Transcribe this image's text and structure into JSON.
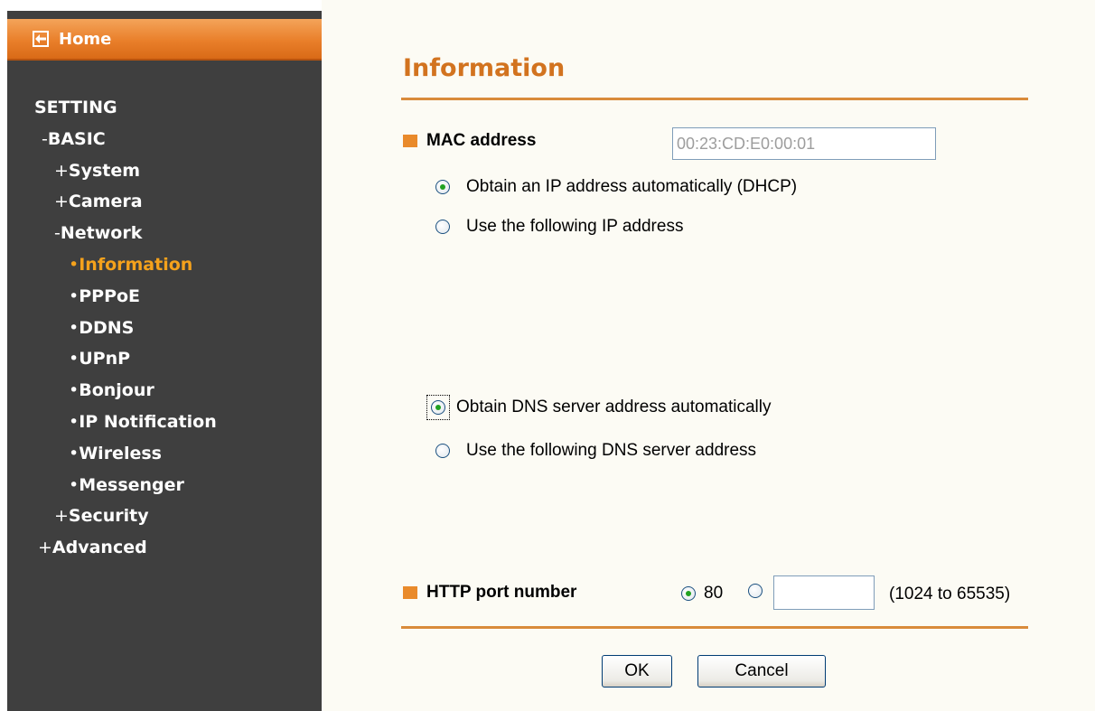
{
  "sidebar": {
    "home_label": "Home",
    "items": [
      {
        "prefix": "",
        "label": "SETTING",
        "level": 0,
        "active": false
      },
      {
        "prefix": "-",
        "label": "BASIC",
        "level": 1,
        "active": false
      },
      {
        "prefix": "+",
        "label": "System",
        "level": 2,
        "active": false
      },
      {
        "prefix": "+",
        "label": "Camera",
        "level": 2,
        "active": false
      },
      {
        "prefix": "-",
        "label": "Network",
        "level": 2,
        "active": false
      },
      {
        "prefix": "•",
        "label": "Information",
        "level": 3,
        "active": true
      },
      {
        "prefix": "•",
        "label": "PPPoE",
        "level": 3,
        "active": false
      },
      {
        "prefix": "•",
        "label": "DDNS",
        "level": 3,
        "active": false
      },
      {
        "prefix": "•",
        "label": "UPnP",
        "level": 3,
        "active": false
      },
      {
        "prefix": "•",
        "label": "Bonjour",
        "level": 3,
        "active": false
      },
      {
        "prefix": "•",
        "label": "IP Notification",
        "level": 3,
        "active": false
      },
      {
        "prefix": "•",
        "label": "Wireless",
        "level": 3,
        "active": false
      },
      {
        "prefix": "•",
        "label": "Messenger",
        "level": 3,
        "active": false
      },
      {
        "prefix": "+",
        "label": "Security",
        "level": 2,
        "active": false
      },
      {
        "prefix": "+",
        "label": "Advanced",
        "level": 0,
        "active": false
      }
    ]
  },
  "main": {
    "title": "Information",
    "mac": {
      "label": "MAC address",
      "value": "00:23:CD:E0:00:01"
    },
    "ip_options": {
      "dhcp_label": "Obtain an IP address automatically (DHCP)",
      "dhcp_selected": true,
      "static_label": "Use the following IP address",
      "static_selected": false
    },
    "dns_options": {
      "auto_label": "Obtain DNS server address automatically",
      "auto_selected": true,
      "manual_label": "Use the following DNS server address",
      "manual_selected": false
    },
    "http_port": {
      "label": "HTTP port number",
      "default_value": "80",
      "default_selected": true,
      "custom_value": "",
      "range_hint": "(1024 to 65535)"
    },
    "buttons": {
      "ok": "OK",
      "cancel": "Cancel"
    }
  },
  "colors": {
    "sidebar_bg": "#3f3f3f",
    "home_bar": "#e97f2a",
    "active_item": "#f5a21c",
    "title": "#d2731f",
    "rule": "#d98b3b",
    "radio_dot": "#21a121"
  }
}
